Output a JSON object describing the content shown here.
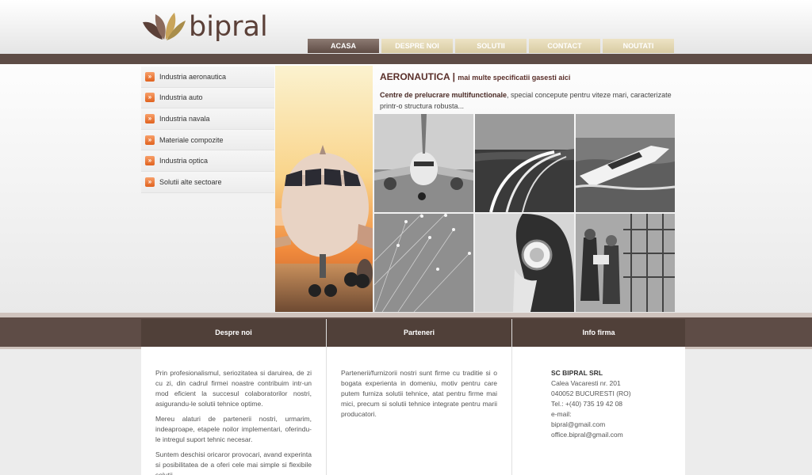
{
  "brand": {
    "name": "bipral"
  },
  "nav": {
    "items": [
      "ACASA",
      "DESPRE NOI",
      "SOLUTII",
      "CONTACT",
      "NOUTATI"
    ],
    "active": "ACASA"
  },
  "sidebar": {
    "items": [
      "Industria aeronautica",
      "Industria auto",
      "Industria navala",
      "Materiale compozite",
      "Industria optica",
      "Solutii alte sectoare"
    ]
  },
  "content": {
    "title": "AERONAUTICA",
    "separator": "|",
    "subtitle": "mai multe specificatii gasesti aici",
    "lead_bold": "Centre de prelucrare multifunctionale",
    "lead_rest": ", special concepute pentru viteze mari, caracterizate printr-o structura robusta..."
  },
  "footer": {
    "col1": {
      "title": "Despre noi",
      "paragraphs": [
        "Prin profesionalismul, seriozitatea si daruirea, de zi cu zi, din cadrul firmei noastre contribuim intr-un mod eficient la succesul colaboratorilor nostri, asigurandu-le solutii tehnice optime.",
        "Mereu alaturi de partenerii nostri, urmarim, indeaproape, etapele noilor implementari, oferindu-le intregul suport tehnic necesar.",
        "Suntem deschisi oricaror provocari, avand experinta si posibilitatea de a oferi cele mai simple si flexibile solutii."
      ]
    },
    "col2": {
      "title": "Parteneri",
      "text": "Partenerii/furnizorii nostri sunt firme cu traditie si o bogata experienta in domeniu, motiv pentru care putem furniza solutii tehnice, atat pentru firme mai mici, precum si solutii tehnice integrate pentru marii producatori."
    },
    "col3": {
      "title": "Info firma",
      "company": "SC BIPRAL SRL",
      "address1": "Calea Vacaresti nr. 201",
      "address2": "040052 BUCURESTI (RO)",
      "phone": "Tel.: +(40) 735 19 42 08",
      "email_label": "e-mail:",
      "email1": "bipral@gmail.com",
      "email2": "office.bipral@gmail.com"
    }
  },
  "colors": {
    "brown": "#5e4c46",
    "beige": "#d8cba3",
    "orange": "#e0621e",
    "title": "#5a2f2a"
  }
}
